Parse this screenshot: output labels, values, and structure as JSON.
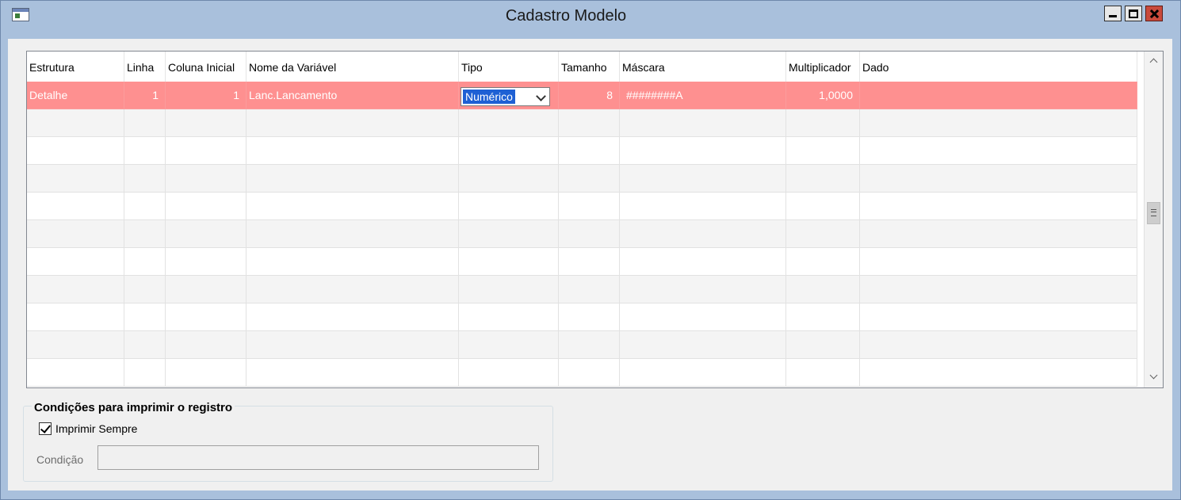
{
  "window": {
    "title": "Cadastro Modelo"
  },
  "grid": {
    "columns": [
      "Estrutura",
      "Linha",
      "Coluna Inicial",
      "Nome da Variável",
      "Tipo",
      "Tamanho",
      "Máscara",
      "Multiplicador",
      "Dado"
    ],
    "rows": [
      {
        "estrutura": "Detalhe",
        "linha": "1",
        "coluna_inicial": "1",
        "nome_variavel": "Lanc.Lancamento",
        "tipo": "Numérico",
        "tamanho": "8",
        "mascara": "########A",
        "multiplicador": "1,0000",
        "dado": ""
      }
    ],
    "selected_row_color": "#fe9090"
  },
  "conditions": {
    "title": "Condições para imprimir o registro",
    "print_always_label": "Imprimir Sempre",
    "print_always_checked": true,
    "condition_label": "Condição",
    "condition_value": ""
  },
  "icons": {
    "app": "app-window-icon",
    "minimize": "minimize-icon",
    "maximize": "maximize-icon",
    "close": "close-icon"
  }
}
